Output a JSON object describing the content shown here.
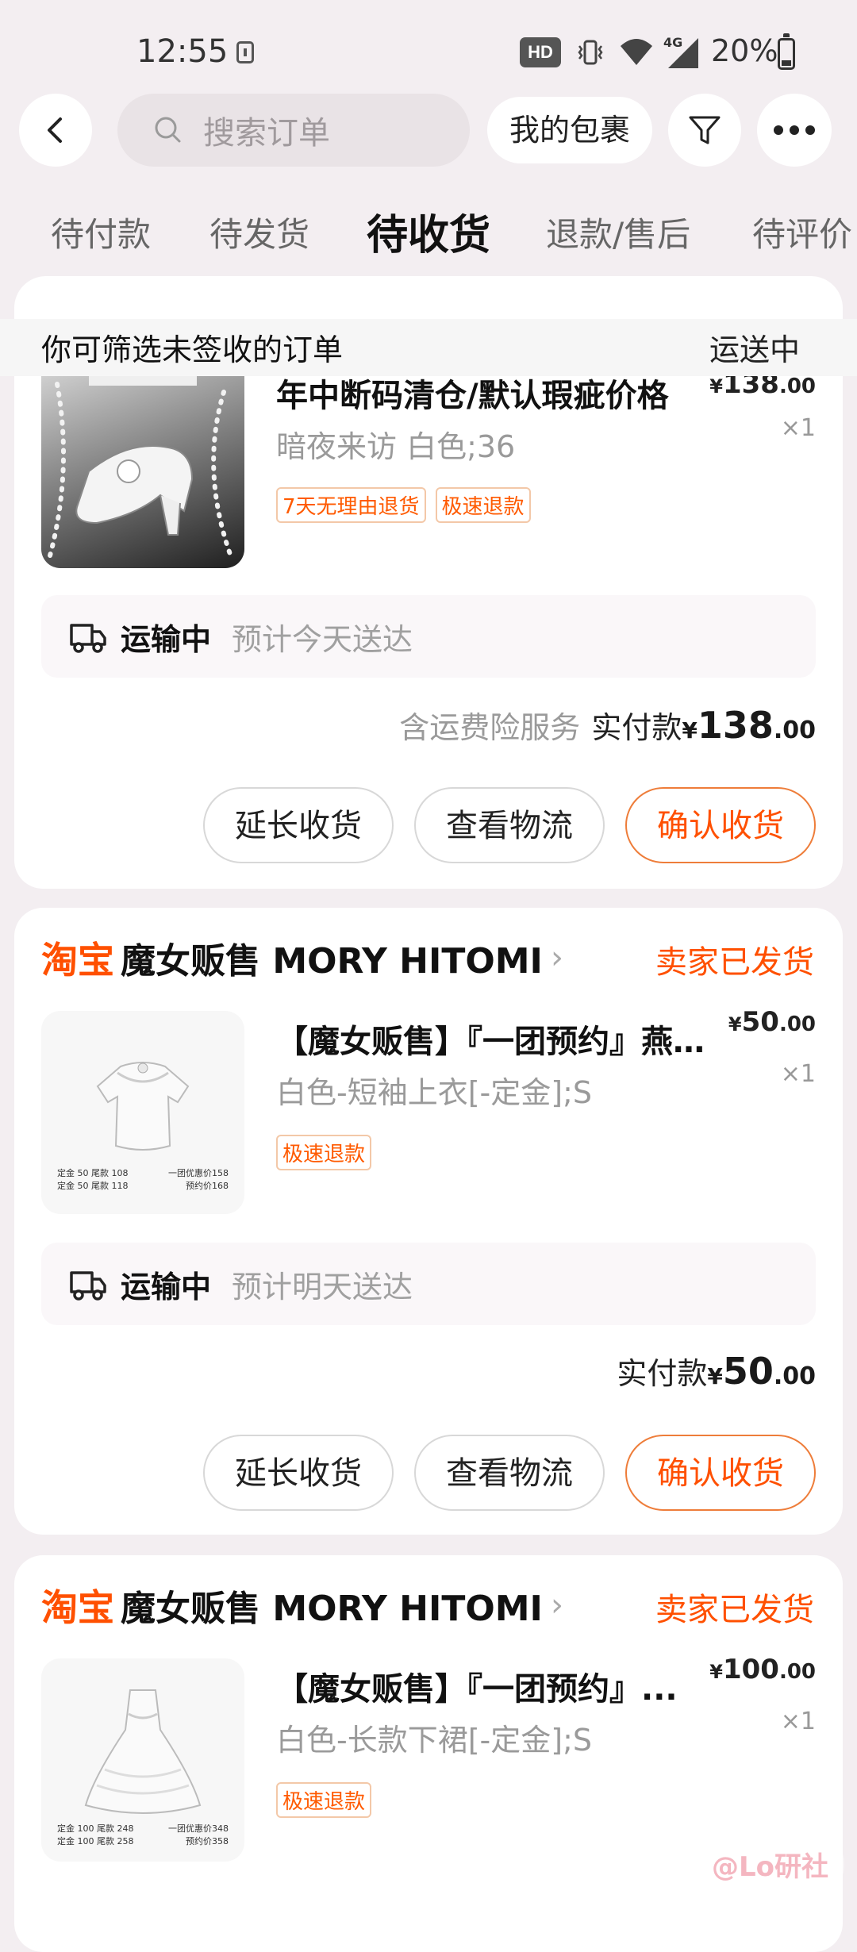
{
  "status_bar": {
    "time": "12:55",
    "hd": "HD",
    "net": "4G",
    "battery": "20%"
  },
  "header": {
    "search_placeholder": "搜索订单",
    "packages_label": "我的包裹"
  },
  "tabs": [
    {
      "label": "待付款"
    },
    {
      "label": "待发货"
    },
    {
      "label": "待收货"
    },
    {
      "label": "退款/售后"
    },
    {
      "label": "待评价"
    }
  ],
  "info_bar": {
    "left": "你可筛选未签收的订单",
    "right": "运送中"
  },
  "orders": [
    {
      "product_title": "年中断码清仓/默认瑕疵价格",
      "spec": "暗夜来访  白色;36",
      "tags": [
        "7天无理由退货",
        "极速退款"
      ],
      "price_cur": "¥",
      "price_int": "138",
      "price_dec": ".00",
      "qty": "×1",
      "ship_status": "运输中",
      "ship_eta": "预计今天送达",
      "pay_note": "含运费险服务",
      "pay_label": "实付款",
      "pay_cur": "¥",
      "pay_int": "138",
      "pay_dec": ".00",
      "buttons": [
        "延长收货",
        "查看物流",
        "确认收货"
      ]
    },
    {
      "shop_logo": "淘宝",
      "shop_name": "魔女贩售 MORY HITOMI",
      "shop_status": "卖家已发货",
      "product_title": "【魔女贩售】『一团预约』燕...",
      "spec": "白色-短袖上衣[-定金];S",
      "tags": [
        "极速退款"
      ],
      "price_cur": "¥",
      "price_int": "50",
      "price_dec": ".00",
      "qty": "×1",
      "thumb_text_1": "定金 50  尾款 108",
      "thumb_text_2": "定金 50  尾款 118",
      "thumb_text_3": "一团优惠价158",
      "thumb_text_4": "预约价168",
      "ship_status": "运输中",
      "ship_eta": "预计明天送达",
      "pay_label": "实付款",
      "pay_cur": "¥",
      "pay_int": "50",
      "pay_dec": ".00",
      "buttons": [
        "延长收货",
        "查看物流",
        "确认收货"
      ]
    },
    {
      "shop_logo": "淘宝",
      "shop_name": "魔女贩售 MORY HITOMI",
      "shop_status": "卖家已发货",
      "product_title": "【魔女贩售】『一团预约』...",
      "spec": "白色-长款下裙[-定金];S",
      "tags": [
        "极速退款"
      ],
      "price_cur": "¥",
      "price_int": "100",
      "price_dec": ".00",
      "qty": "×1",
      "thumb_text_1": "定金 100  尾款 248",
      "thumb_text_2": "定金 100  尾款 258",
      "thumb_text_3": "一团优惠价348",
      "thumb_text_4": "预约价358"
    }
  ],
  "watermark": "@Lo研社",
  "colors": {
    "accent": "#ff5000",
    "background": "#f3eef1"
  }
}
